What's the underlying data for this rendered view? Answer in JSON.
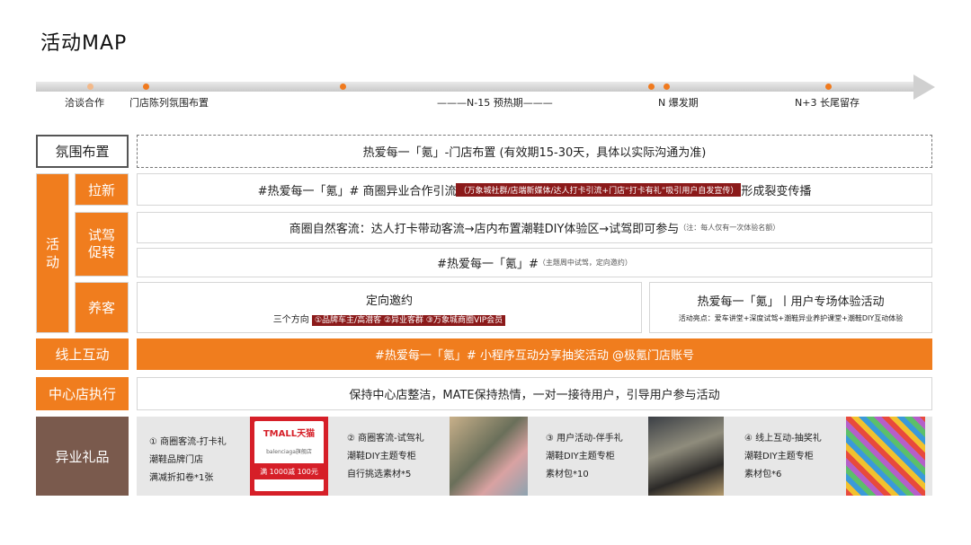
{
  "title": "活动MAP",
  "timeline": {
    "labels": [
      "洽谈合作",
      "门店陈列氛围布置",
      "———N-15  预热期———",
      "N 爆发期",
      "N+3  长尾留存"
    ]
  },
  "rows": {
    "atmosphere": {
      "label": "氛围布置",
      "content": "热爱每一「氪」-门店布置 (有效期15-30天，具体以实际沟通为准)"
    },
    "activity": {
      "label": "活\n动"
    },
    "laxin": {
      "label": "拉新",
      "pre": "#热爱每一「氪」#  商圈异业合作引流",
      "highlight": "（万象城社群/店端新媒体/达人打卡引流+门店“打卡有礼”吸引用户自发宣传）",
      "post": "形成裂变传播"
    },
    "shijia": {
      "label": "试驾\n促转",
      "line1": "商圈自然客流：达人打卡带动客流→店内布置潮鞋DIY体验区→试驾即可参与",
      "line1_note": "（注：每人仅有一次体验名额）",
      "line2": "#热爱每一「氪」#",
      "line2_note": "（主题周中试驾，定向邀约）"
    },
    "yangke": {
      "label": "养客",
      "left_title": "定向邀约",
      "left_pre": "三个方向",
      "left_highlight": "①品牌车主/高潜客 ②异业客群 ③万象城商圈VIP会员",
      "right_title": "热爱每一「氪」丨用户专场体验活动",
      "right_sub": "活动亮点：爱车讲堂+深度试驾+潮鞋异业养护课堂+潮鞋DIY互动体验"
    },
    "online": {
      "label": "线上互动",
      "content": "#热爱每一「氪」#  小程序互动分享抽奖活动 @极氪门店账号"
    },
    "center": {
      "label": "中心店执行",
      "content": "保持中心店整洁，MATE保持热情，一对一接待用户，引导用户参与活动"
    },
    "gifts": {
      "label": "异业礼品",
      "items": [
        {
          "title": "① 商圈客流-打卡礼",
          "l1": "潮鞋品牌门店",
          "l2": "满减折扣卷*1张"
        },
        {
          "title": "② 商圈客流-试驾礼",
          "l1": "潮鞋DIY主题专柜",
          "l2": "自行挑选素材*5"
        },
        {
          "title": "③ 用户活动-伴手礼",
          "l1": "潮鞋DIY主题专柜",
          "l2": "素材包*10"
        },
        {
          "title": "④ 线上互动-抽奖礼",
          "l1": "潮鞋DIY主题专柜",
          "l2": "素材包*6"
        }
      ],
      "coupon": {
        "brand": "TMALL天猫",
        "store": "balenciaga旗舰店",
        "offer": "满 1000减 100元"
      }
    }
  }
}
